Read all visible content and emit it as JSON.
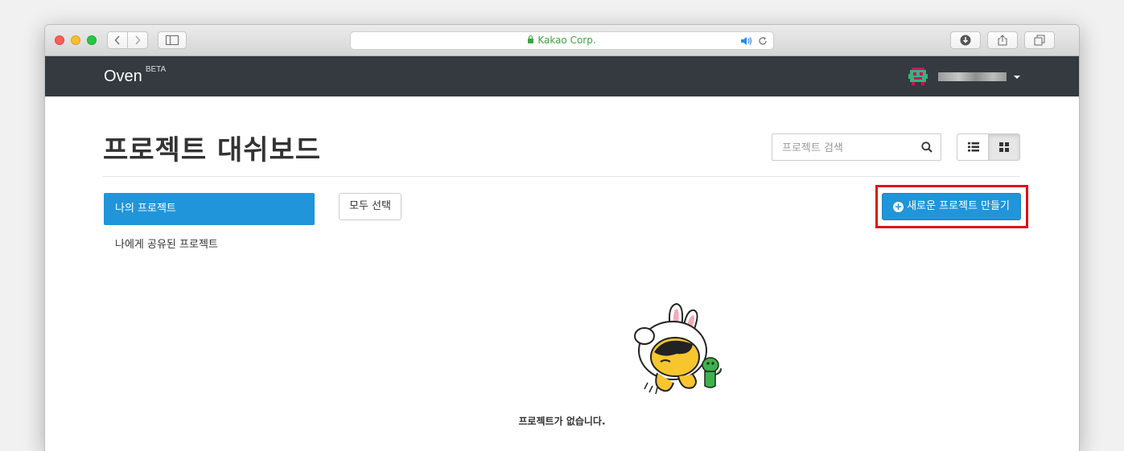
{
  "browser": {
    "url_text": "Kakao Corp.",
    "new_tab_label": "+"
  },
  "navbar": {
    "brand": "Oven",
    "brand_badge": "BETA"
  },
  "main": {
    "title": "프로젝트 대쉬보드",
    "search_placeholder": "프로젝트 검색",
    "sidebar": {
      "active_item": "나의 프로젝트",
      "item": "나에게 공유된 프로젝트"
    },
    "select_all_label": "모두 선택",
    "new_project_label": "새로운 프로젝트 만들기",
    "empty_message": "프로젝트가 없습니다."
  },
  "colors": {
    "accent": "#2095d9",
    "navbar": "#343a3f",
    "highlight": "#e0101a",
    "secure": "#3ea340"
  }
}
